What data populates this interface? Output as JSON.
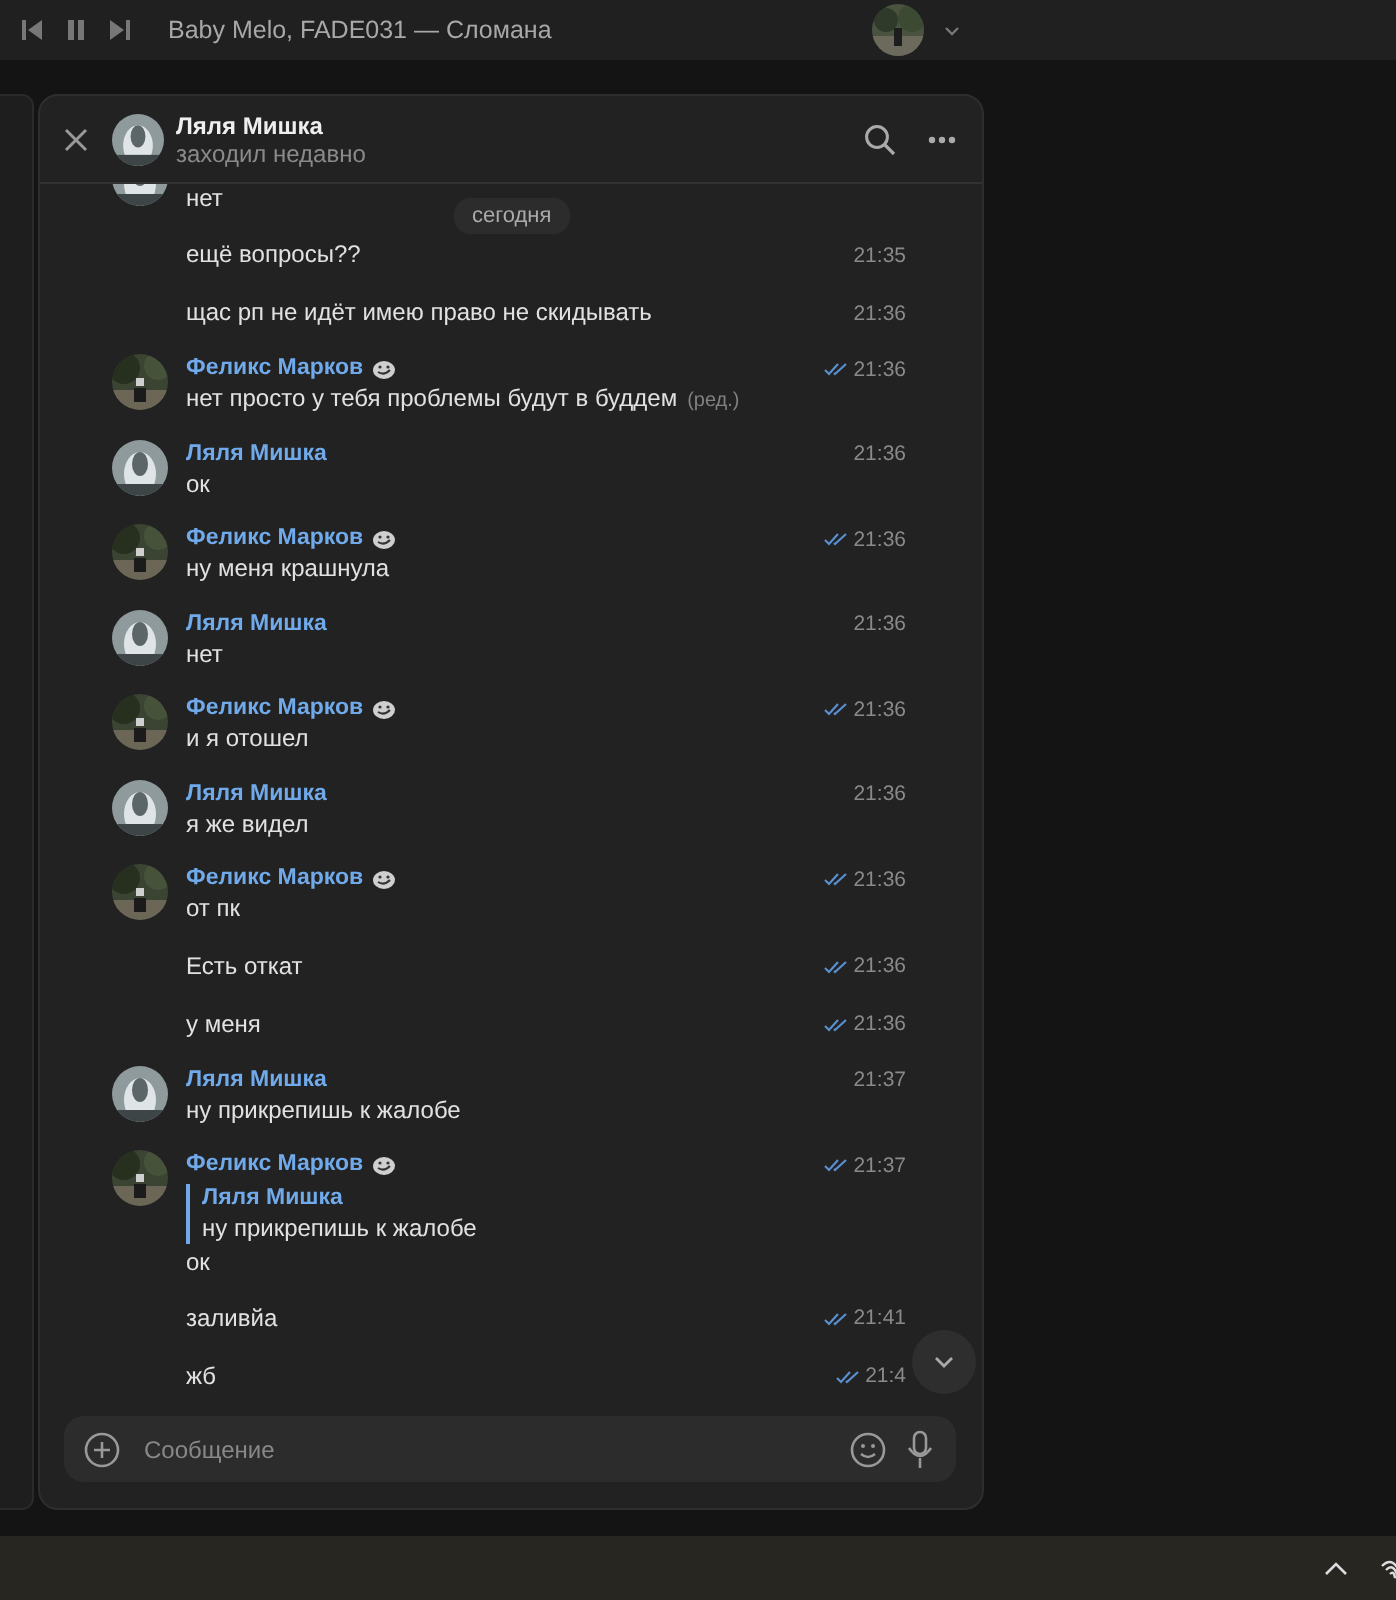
{
  "player": {
    "track": "Baby Melo, FADE031 — Сломана"
  },
  "chat": {
    "title": "Ляля Мишка",
    "status": "заходил недавно",
    "date_label": "сегодня",
    "messages": [
      {
        "kind": "tail",
        "outgoing": false,
        "text": "нет"
      },
      {
        "kind": "more",
        "read": false,
        "text": "ещё вопросы??",
        "time": "21:35"
      },
      {
        "kind": "more",
        "read": false,
        "text": "щас рп не идёт имею право не скидывать",
        "time": "21:36"
      },
      {
        "kind": "full",
        "outgoing": true,
        "status_emoji": true,
        "author": "Феликс Марков",
        "read": true,
        "text": "нет просто у тебя проблемы будут в буддем",
        "edited": "(ред.)",
        "time": "21:36"
      },
      {
        "kind": "full",
        "outgoing": false,
        "status_emoji": false,
        "author": "Ляля Мишка",
        "read": false,
        "text": "ок",
        "time": "21:36"
      },
      {
        "kind": "full",
        "outgoing": true,
        "status_emoji": true,
        "author": "Феликс Марков",
        "read": true,
        "text": "ну меня крашнула",
        "time": "21:36"
      },
      {
        "kind": "full",
        "outgoing": false,
        "status_emoji": false,
        "author": "Ляля Мишка",
        "read": false,
        "text": "нет",
        "time": "21:36"
      },
      {
        "kind": "full",
        "outgoing": true,
        "status_emoji": true,
        "author": "Феликс Марков",
        "read": true,
        "text": "и я отошел",
        "time": "21:36"
      },
      {
        "kind": "full",
        "outgoing": false,
        "status_emoji": false,
        "author": "Ляля Мишка",
        "read": false,
        "text": "я же видел",
        "time": "21:36"
      },
      {
        "kind": "full",
        "outgoing": true,
        "status_emoji": true,
        "author": "Феликс Марков",
        "read": true,
        "text": "от пк",
        "time": "21:36"
      },
      {
        "kind": "more",
        "read": true,
        "text": "Есть откат",
        "time": "21:36"
      },
      {
        "kind": "more",
        "read": true,
        "text": "у меня",
        "time": "21:36"
      },
      {
        "kind": "full",
        "outgoing": false,
        "status_emoji": false,
        "author": "Ляля Мишка",
        "read": false,
        "text": "ну прикрепишь к жалобе",
        "time": "21:37"
      },
      {
        "kind": "full",
        "outgoing": true,
        "status_emoji": true,
        "author": "Феликс Марков",
        "read": true,
        "reply": {
          "author": "Ляля Мишка",
          "text": "ну прикрепишь к жалобе"
        },
        "text": "ок",
        "time": "21:37"
      },
      {
        "kind": "more",
        "read": true,
        "text": "заливйа",
        "time": "21:41"
      },
      {
        "kind": "more",
        "read": true,
        "text": "жб",
        "time": "21:4"
      }
    ],
    "composer": {
      "placeholder": "Сообщение"
    }
  }
}
